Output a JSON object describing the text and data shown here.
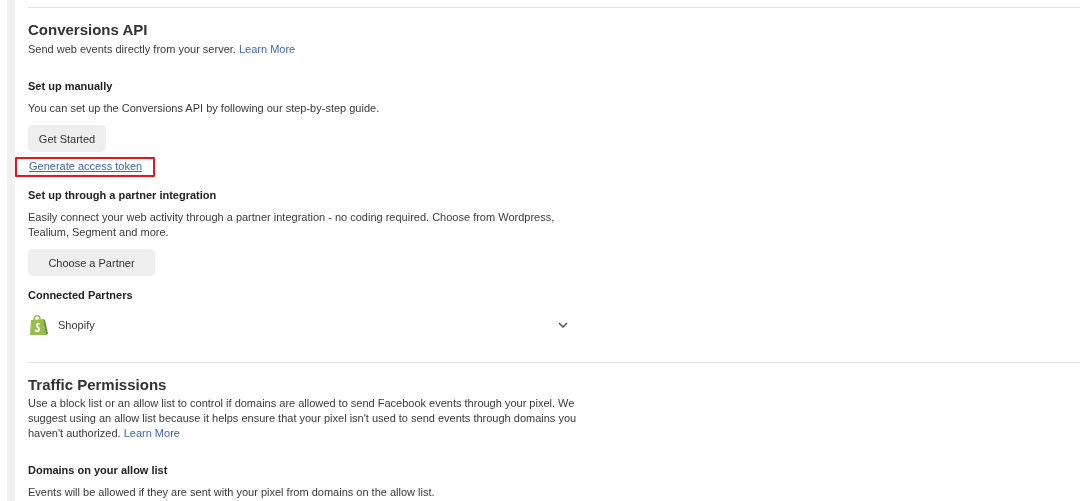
{
  "conversions_api": {
    "title": "Conversions API",
    "description": "Send web events directly from your server.",
    "learn_more": "Learn More",
    "manual": {
      "heading": "Set up manually",
      "description": "You can set up the Conversions API by following our step-by-step guide.",
      "button": "Get Started",
      "link": {
        "label": "Generate access token",
        "highlighted": true
      }
    },
    "partner": {
      "heading": "Set up through a partner integration",
      "description": "Easily connect your web activity through a partner integration - no coding required. Choose from Wordpress, Tealium, Segment and more.",
      "button": "Choose a Partner"
    },
    "connected": {
      "heading": "Connected Partners",
      "partners": [
        {
          "name": "Shopify",
          "expanded": false
        }
      ]
    }
  },
  "traffic_permissions": {
    "title": "Traffic Permissions",
    "description": "Use a block list or an allow list to control if domains are allowed to send Facebook events through your pixel. We suggest using an allow list because it helps ensure that your pixel isn't used to send events through domains you haven't authorized.",
    "learn_more": "Learn More",
    "allow_list": {
      "heading": "Domains on your allow list",
      "description": "Events will be allowed if they are sent with your pixel from domains on the allow list."
    }
  }
}
